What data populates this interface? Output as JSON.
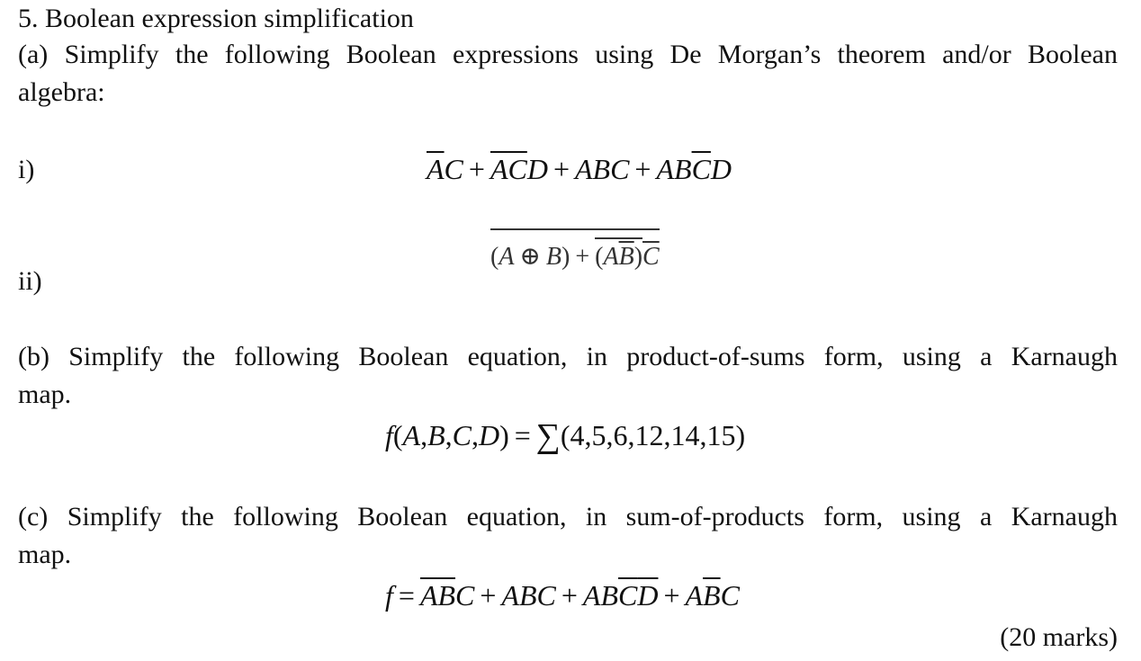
{
  "question": {
    "title": "5. Boolean expression simplification",
    "part_a": {
      "prompt_line1": "(a) Simplify the following Boolean expressions using De Morgan’s theorem and/or Boolean",
      "prompt_line2": "algebra:",
      "items": [
        {
          "label": "i)",
          "expression": "A̅C + A̅C̅D + ABC + ABC̅D"
        },
        {
          "label": "ii)",
          "expression": "NOT[(A ⊕ B) + NOT(AB̅) · C̅]"
        }
      ]
    },
    "part_b": {
      "prompt_line1": "(b) Simplify the following Boolean equation, in product-of-sums form, using a Karnaugh",
      "prompt_line2": "map.",
      "equation_lhs": "f(A,B,C,D) =",
      "sigma": "∑",
      "minterms": "(4,5,6,12,14,15)"
    },
    "part_c": {
      "prompt_line1": "(c) Simplify the following Boolean equation, in sum-of-products form, using a Karnaugh",
      "prompt_line2": "map.",
      "equation": "f = A̅B̅C + ABC + ABC̅D̅ + AB̅C"
    },
    "marks": "(20 marks)",
    "symbols": {
      "A": "A",
      "B": "B",
      "C": "C",
      "D": "D",
      "f": "f",
      "plus": "+",
      "equals": "=",
      "xor": "⊕",
      "lparen": "(",
      "rparen": ")"
    }
  }
}
